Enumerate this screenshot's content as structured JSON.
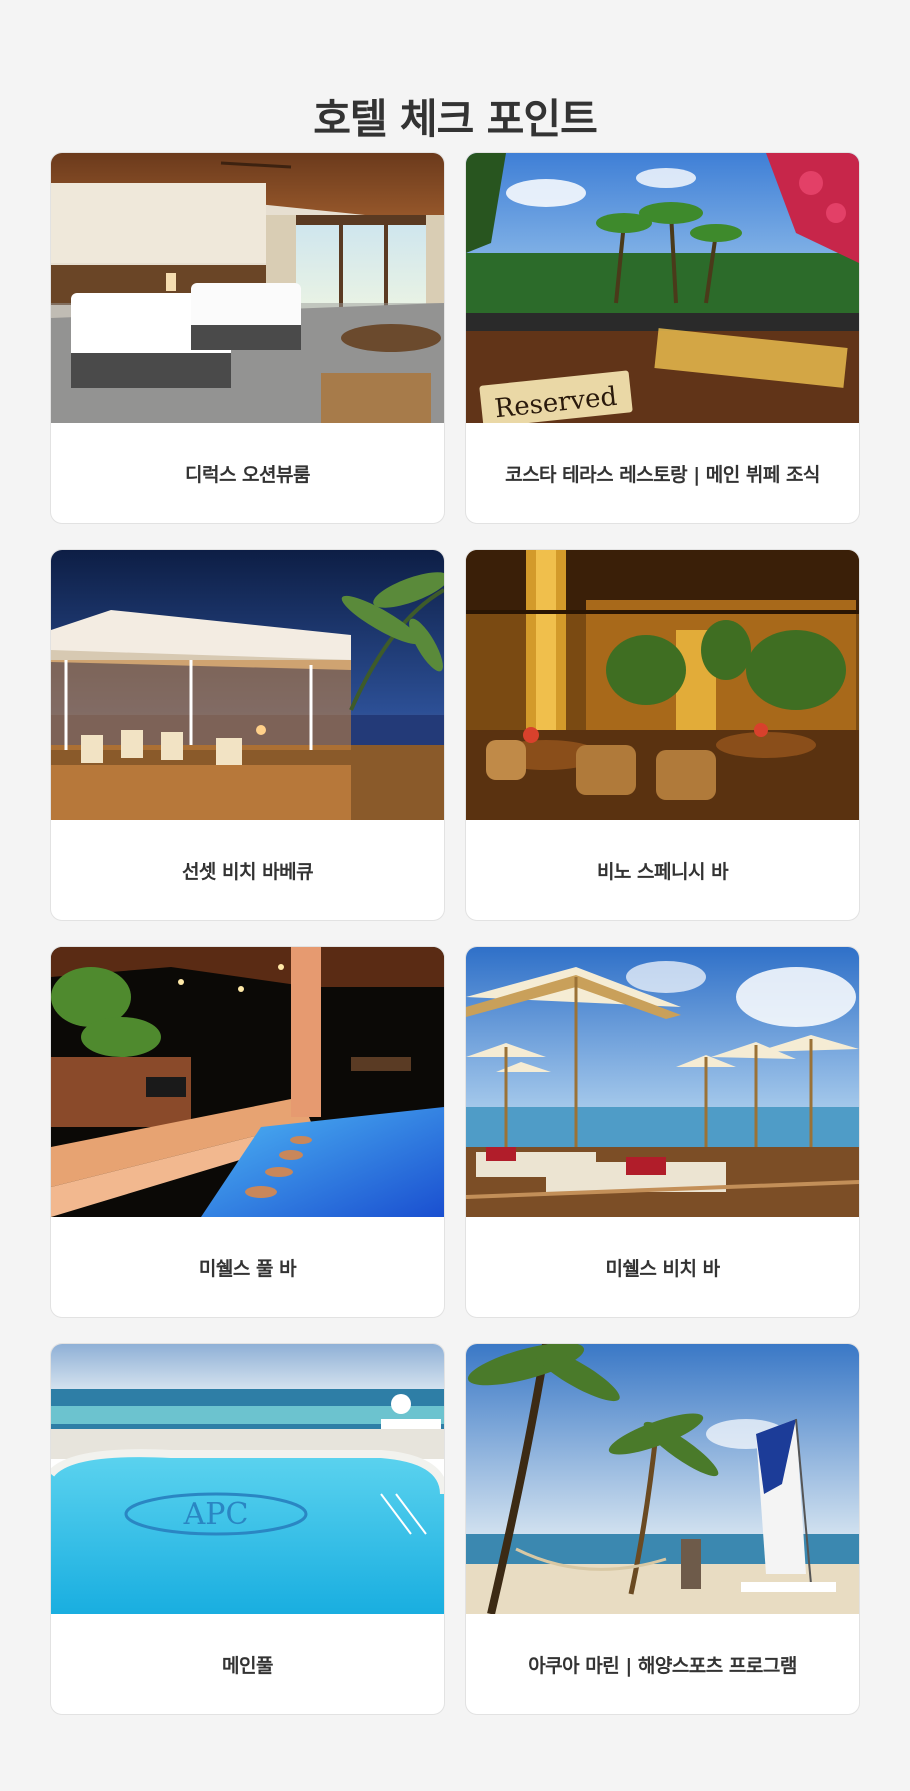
{
  "page": {
    "title": "호텔 체크 포인트"
  },
  "cards": [
    {
      "label": "디럭스 오션뷰룸",
      "photo": "deluxe-ocean-view-room-photo"
    },
    {
      "label": "코스타 테라스 레스토랑 | 메인 뷔페 조식",
      "photo": "costa-terrace-restaurant-photo",
      "sign_text": "Reserved"
    },
    {
      "label": "선셋 비치 바베큐",
      "photo": "sunset-beach-bbq-photo"
    },
    {
      "label": "비노 스페니시 바",
      "photo": "vino-spanish-bar-photo"
    },
    {
      "label": "미쉘스 풀 바",
      "photo": "michelles-pool-bar-photo"
    },
    {
      "label": "미쉘스 비치 바",
      "photo": "michelles-beach-bar-photo"
    },
    {
      "label": "메인풀",
      "photo": "main-pool-photo",
      "pool_logo": "APC"
    },
    {
      "label": "아쿠아 마린 | 해양스포츠 프로그램",
      "photo": "aqua-marine-watersports-photo"
    }
  ],
  "colors": {
    "page_background": "#f4f4f4",
    "card_background": "#ffffff",
    "text": "#333333",
    "card_border": "#e2e2e2"
  }
}
